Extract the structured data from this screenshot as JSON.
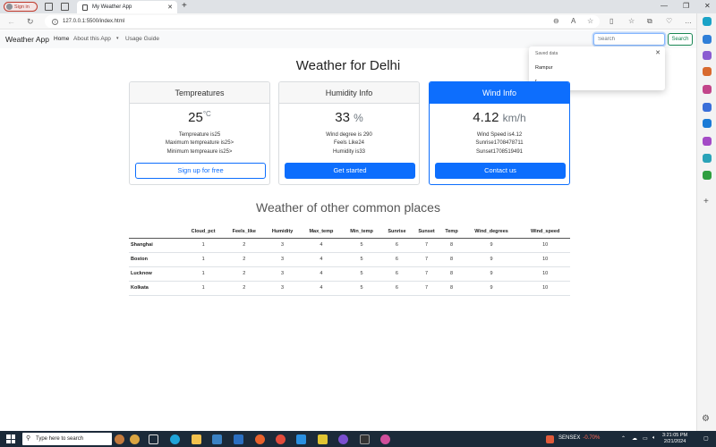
{
  "browser": {
    "signin_label": "Sign in",
    "tab_title": "My Weather App",
    "url": "127.0.0.1:5500/index.html"
  },
  "navbar": {
    "brand": "Weather App",
    "links": [
      "Home",
      "About this App",
      "Usage Guide"
    ],
    "search_placeholder": "Search",
    "search_button": "Search"
  },
  "saved_dropdown": {
    "title": "Saved data",
    "items": [
      "Rampur",
      "r"
    ]
  },
  "main": {
    "title": "Weather for Delhi",
    "cards": [
      {
        "header": "Tempreatures",
        "big_value": "25",
        "big_unit": "°C",
        "lines": [
          "Tempreature is25",
          "Maximum tempreature is25>",
          "Minimum tempreaure is25>"
        ],
        "button": "Sign up for free"
      },
      {
        "header": "Humidity Info",
        "big_value": "33",
        "big_unit": "%",
        "lines": [
          "Wind degree is 290",
          "Feels Like24",
          "Humidity is33"
        ],
        "button": "Get started"
      },
      {
        "header": "Wind Info",
        "big_value": "4.12",
        "big_unit": "km/h",
        "lines": [
          "Wind Speed is4.12",
          "Sunrise1708478711",
          "Sunset1708519491"
        ],
        "button": "Contact us"
      }
    ],
    "subtitle": "Weather of other common places",
    "table": {
      "headers": [
        "",
        "Cloud_pct",
        "Feels_like",
        "Humidity",
        "Max_temp",
        "Min_temp",
        "Sunrise",
        "Sunset",
        "Temp",
        "Wind_degrees",
        "Wind_speed"
      ],
      "rows": [
        [
          "Shanghai",
          "1",
          "2",
          "3",
          "4",
          "5",
          "6",
          "7",
          "8",
          "9",
          "10"
        ],
        [
          "Boston",
          "1",
          "2",
          "3",
          "4",
          "5",
          "6",
          "7",
          "8",
          "9",
          "10"
        ],
        [
          "Lucknow",
          "1",
          "2",
          "3",
          "4",
          "5",
          "6",
          "7",
          "8",
          "9",
          "10"
        ],
        [
          "Kolkata",
          "1",
          "2",
          "3",
          "4",
          "5",
          "6",
          "7",
          "8",
          "9",
          "10"
        ]
      ]
    }
  },
  "taskbar": {
    "search_placeholder": "Type here to search",
    "sensex_label": "SENSEX",
    "sensex_change": "-0.70%",
    "time": "3:21:05 PM",
    "date": "2/21/2024"
  },
  "colors": {
    "primary": "#0d6efd",
    "success": "#198754",
    "taskbar": "#1b2a39"
  }
}
